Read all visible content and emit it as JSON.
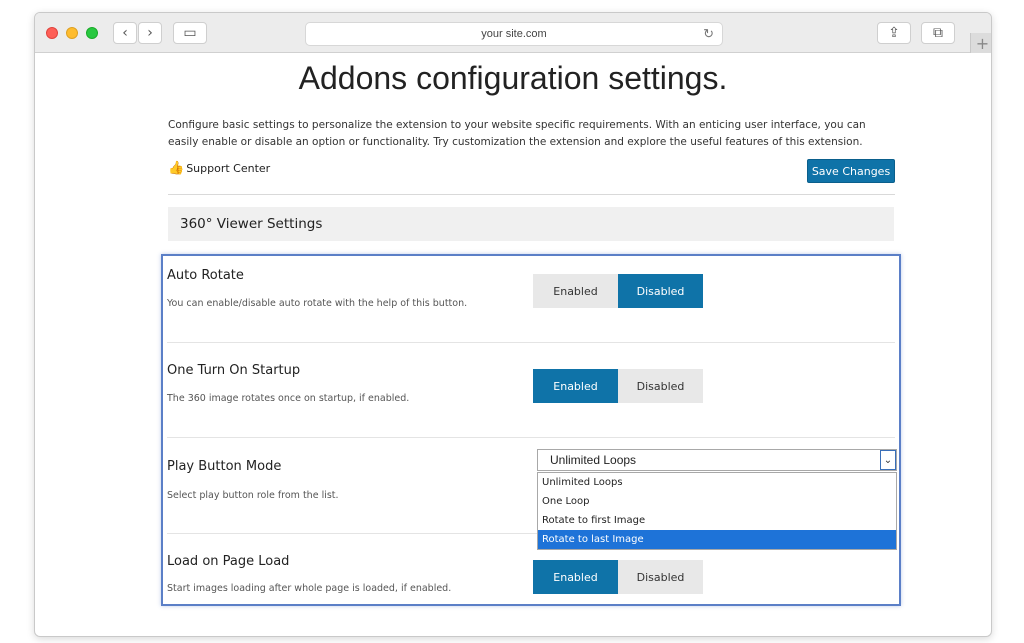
{
  "browser": {
    "address": "your site.com",
    "nav_back": "‹",
    "nav_fwd": "›",
    "sidebar_icon": "▭",
    "reload_icon": "↻",
    "share_icon": "⇪",
    "tabs_icon": "⧉",
    "newtab_icon": "+"
  },
  "page": {
    "title": "Addons configuration settings.",
    "description": "Configure basic settings to personalize the extension to your website specific requirements. With an enticing user interface, you can easily enable or disable an option or functionality. Try customization the extension and explore the useful features of this extension.",
    "support_icon": "👍",
    "support_label": "Support Center",
    "save_label": "Save Changes",
    "section_title": "360° Viewer Settings"
  },
  "settings": {
    "auto_rotate": {
      "title": "Auto Rotate",
      "desc": "You can enable/disable auto rotate with the help of this button.",
      "enabled_label": "Enabled",
      "disabled_label": "Disabled",
      "selected": "Disabled"
    },
    "one_turn": {
      "title": "One Turn On Startup",
      "desc": "The 360 image rotates once on startup, if enabled.",
      "enabled_label": "Enabled",
      "disabled_label": "Disabled",
      "selected": "Enabled"
    },
    "play_mode": {
      "title": "Play Button Mode",
      "desc": "Select play button role from the list.",
      "value": "Unlimited Loops",
      "arrow": "⌄",
      "options": [
        "Unlimited Loops",
        "One Loop",
        "Rotate to first Image",
        "Rotate to last Image"
      ],
      "highlighted": "Rotate to last Image"
    },
    "load_on_page": {
      "title": "Load on Page Load",
      "desc": "Start images loading after whole page is loaded, if enabled.",
      "enabled_label": "Enabled",
      "disabled_label": "Disabled",
      "selected": "Enabled"
    }
  },
  "colors": {
    "accent": "#0f73a8",
    "highlight_border": "#5b7fc7",
    "dropdown_selected": "#1e73d8"
  }
}
